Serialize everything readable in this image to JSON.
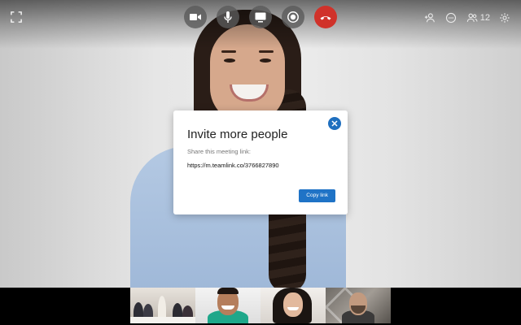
{
  "top_bar": {
    "fullscreen_icon": "fullscreen-icon",
    "controls": [
      {
        "name": "video-icon"
      },
      {
        "name": "microphone-icon"
      },
      {
        "name": "screen-share-icon"
      },
      {
        "name": "record-icon"
      },
      {
        "name": "end-call-icon"
      }
    ],
    "participant_count": "12"
  },
  "modal": {
    "title": "Invite more people",
    "subtitle": "Share this meeting link:",
    "link": "https://m.teamlink.co/3766827890",
    "copy_label": "Copy link"
  },
  "colors": {
    "accent": "#1f73c6",
    "end_call": "#d0322a"
  }
}
